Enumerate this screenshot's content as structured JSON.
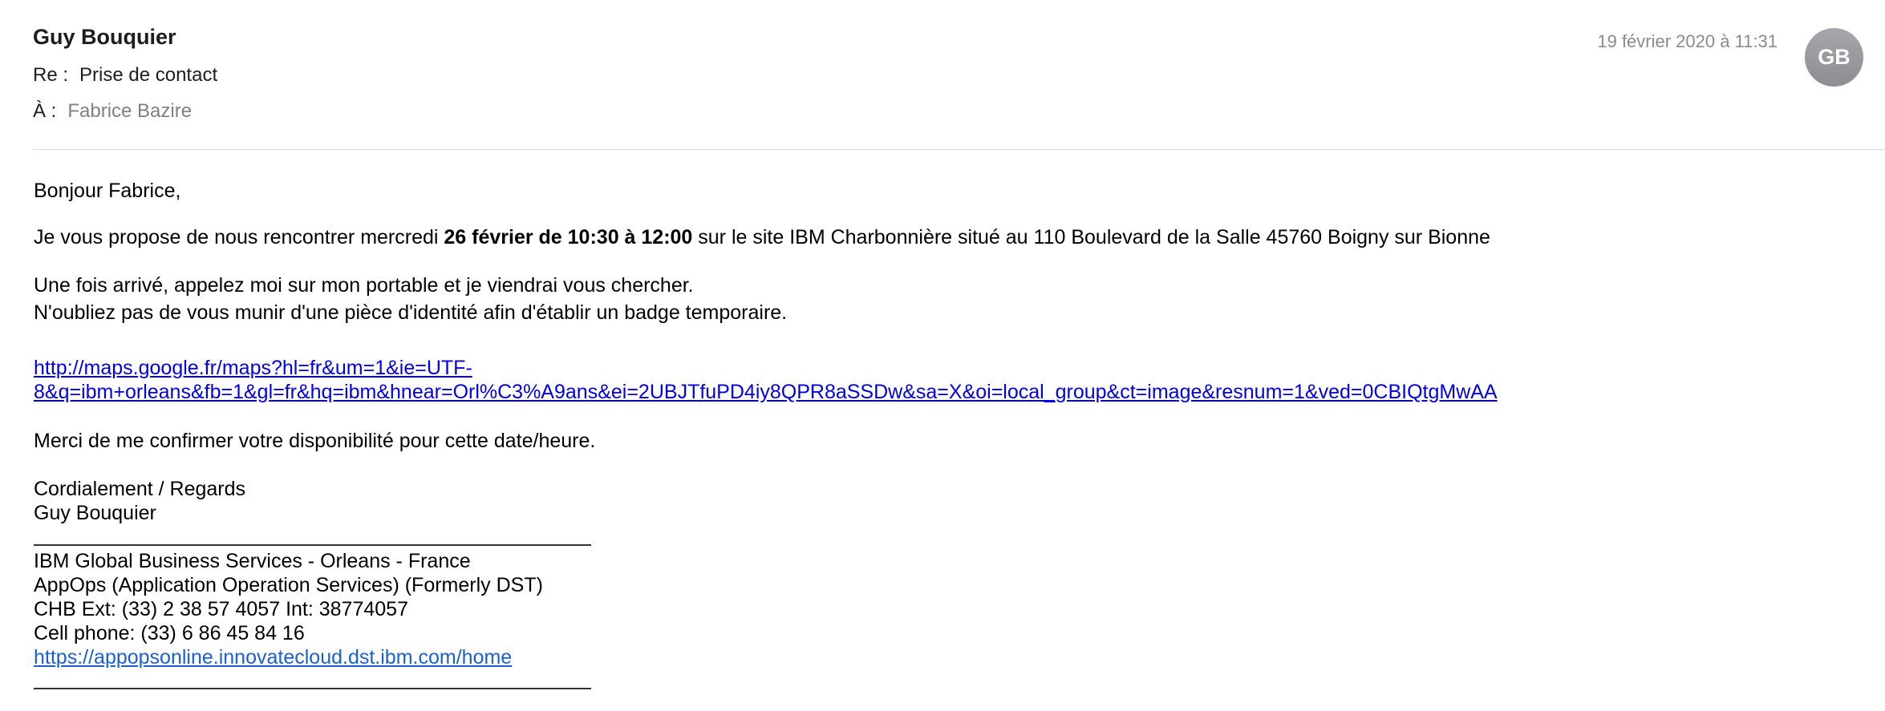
{
  "header": {
    "sender": "Guy Bouquier",
    "subject_label": "Re :",
    "subject": "Prise de contact",
    "to_label": "À :",
    "to": "Fabrice Bazire",
    "date": "19 février 2020 à 11:31",
    "avatar_initials": "GB"
  },
  "body": {
    "greeting": "Bonjour Fabrice,",
    "proposal_prefix": "Je vous propose de nous rencontrer mercredi ",
    "proposal_bold": "26 février de 10:30 à 12:00",
    "proposal_suffix": " sur le site IBM Charbonnière situé au 110 Boulevard de la Salle 45760 Boigny sur Bionne",
    "arrival_line1": "Une fois arrivé, appelez moi sur mon portable et je viendrai vous chercher.",
    "arrival_line2": "N'oubliez pas de vous munir d'une pièce d'identité afin d'établir un badge temporaire.",
    "map_link_line1": "http://maps.google.fr/maps?hl=fr&um=1&ie=UTF-",
    "map_link_line2": "8&q=ibm+orleans&fb=1&gl=fr&hq=ibm&hnear=Orl%C3%A9ans&ei=2UBJTfuPD4iy8QPR8aSSDw&sa=X&oi=local_group&ct=image&resnum=1&ved=0CBIQtgMwAA",
    "confirm": "Merci de me confirmer votre disponibilité pour cette date/heure.",
    "closing": "Cordialement / Regards",
    "closing_name": "Guy Bouquier"
  },
  "signature": {
    "line1": "IBM Global Business Services - Orleans - France",
    "line2": "AppOps (Application Operation Services) (Formerly DST)",
    "line3": "CHB Ext: (33) 2 38 57 4057  Int: 38774057",
    "line4": "Cell phone: (33) 6 86 45 84 16",
    "link": "https://appopsonline.innovatecloud.dst.ibm.com/home"
  }
}
